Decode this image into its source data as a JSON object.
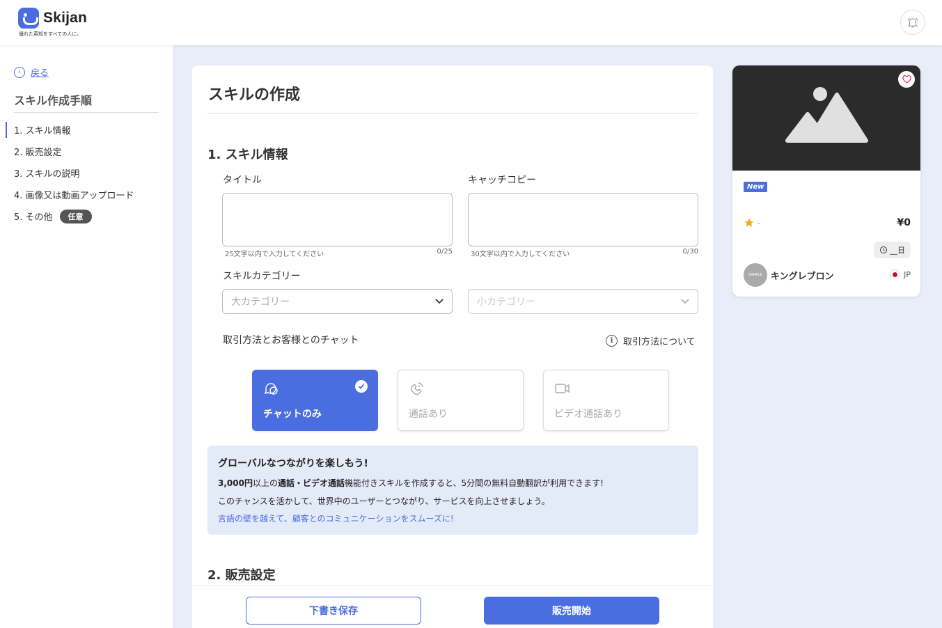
{
  "header": {
    "brand": "Skijan",
    "tagline": "優れた英知をすべての人に。",
    "icons": {
      "logo": "skijan-logo-icon",
      "bell": "bell-icon"
    }
  },
  "sidebar": {
    "back_label": "戻る",
    "title": "スキル作成手順",
    "steps": [
      {
        "label": "1. スキル情報",
        "active": true
      },
      {
        "label": "2. 販売設定"
      },
      {
        "label": "3. スキルの説明"
      },
      {
        "label": "4. 画像又は動画アップロード"
      },
      {
        "label": "5. その他",
        "badge": "任意"
      }
    ]
  },
  "main": {
    "title": "スキルの作成",
    "section1_title": "1. スキル情報",
    "title_field": {
      "label": "タイトル",
      "value": "",
      "hint": "25文字以内で入力してください",
      "count": "0/25"
    },
    "catch_field": {
      "label": "キャッチコピー",
      "value": "",
      "hint": "30文字以内で入力してください",
      "count": "0/30"
    },
    "category": {
      "label": "スキルカテゴリー",
      "major_placeholder": "大カテゴリー",
      "minor_placeholder": "小カテゴリー"
    },
    "transaction": {
      "label": "取引方法とお客様とのチャット",
      "info_link": "取引方法について",
      "options": [
        {
          "label": "チャットのみ",
          "selected": true,
          "icon": "chat-icon"
        },
        {
          "label": "通話あり",
          "selected": false,
          "icon": "phone-icon"
        },
        {
          "label": "ビデオ通話あり",
          "selected": false,
          "icon": "video-icon"
        }
      ]
    },
    "promo": {
      "title": "グローバルなつながりを楽しもう!",
      "line1_a": "3,000円",
      "line1_b": "以上の",
      "line1_c": "通話・ビデオ通話",
      "line1_d": "機能付きスキルを作成すると、5分間の無料自動翻訳が利用できます!",
      "line2": "このチャンスを活かして、世界中のユーザーとつながり、サービスを向上させましょう。",
      "link": "言語の壁を越えて、顧客とのコミュニケーションをスムーズに!"
    },
    "section2_title": "2. 販売設定"
  },
  "actions": {
    "draft_label": "下書き保存",
    "sell_label": "販売開始"
  },
  "preview": {
    "new_badge": "New",
    "rating": "-",
    "price": "¥0",
    "duration": "__日",
    "avatar_text": "SAMPLE",
    "seller": "キングレブロン",
    "country": "JP",
    "colors": {
      "accent": "#4a6ee0",
      "star": "#f5a623",
      "image_bg": "#2b2b2b"
    }
  }
}
